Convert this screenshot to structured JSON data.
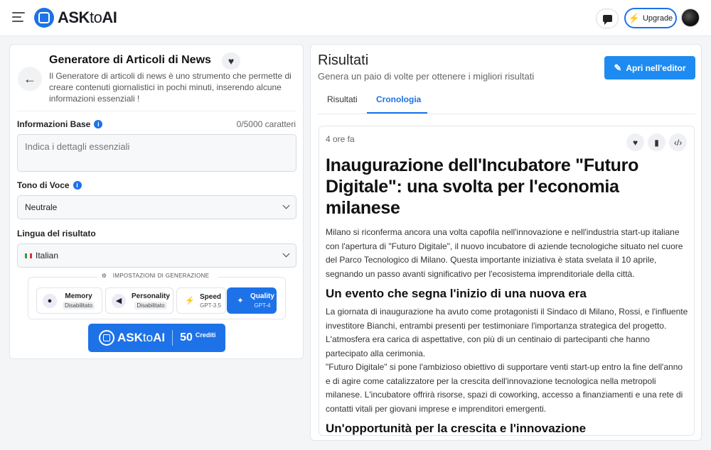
{
  "topbar": {
    "logo_brand_a": "ASK",
    "logo_brand_b": "to",
    "logo_brand_c": "AI",
    "upgrade_label": "Upgrade"
  },
  "generator": {
    "title": "Generatore di Articoli di News",
    "description": "Il Generatore di articoli di news è uno strumento che permette di creare contenuti giornalistici in pochi minuti, inserendo alcune informazioni essenziali !",
    "fields": {
      "base_info_label": "Informazioni Base",
      "char_count": "0/5000 caratteri",
      "base_info_placeholder": "Indica i dettagli essenziali",
      "tone_label": "Tono di Voce",
      "tone_value": "Neutrale",
      "language_label": "Lingua del risultato",
      "language_value": "Italian"
    },
    "settings_label": "IMPOSTAZIONI DI GENERAZIONE",
    "options": [
      {
        "name": "Memory",
        "status": "Disabilitato",
        "icon": "brain-icon"
      },
      {
        "name": "Personality",
        "status": "Disabilitato",
        "icon": "megaphone-icon"
      },
      {
        "name": "Speed",
        "status": "GPT-3.5",
        "icon": "bolt-icon"
      },
      {
        "name": "Quality",
        "status": "GPT-4",
        "icon": "sparkle-icon"
      }
    ],
    "credit_button": {
      "brand_a": "ASK",
      "brand_b": "to",
      "brand_c": "AI",
      "amount": "50",
      "unit": "Crediti"
    }
  },
  "results": {
    "title": "Risultati",
    "subtitle": "Genera un paio di volte per ottenere i migliori risultati",
    "editor_button": "Apri nell'editor",
    "tabs": [
      "Risultati",
      "Cronologia"
    ],
    "active_tab": "Cronologia",
    "card": {
      "time_ago": "4 ore fa",
      "heading": "Inaugurazione dell'Incubatore \"Futuro Digitale\": una svolta per l'economia milanese",
      "paragraph1": "Milano si riconferma ancora una volta capofila nell'innovazione e nell'industria start-up italiane con l'apertura di \"Futuro Digitale\", il nuovo incubatore di aziende tecnologiche situato nel cuore del Parco Tecnologico di Milano. Questa importante iniziativa è stata svelata il 10 aprile, segnando un passo avanti significativo per l'ecosistema imprenditoriale della città.",
      "subheading1": "Un evento che segna l'inizio di una nuova era",
      "paragraph2": "La giornata di inaugurazione ha avuto come protagonisti il Sindaco di Milano, Rossi, e l'influente investitore Bianchi, entrambi presenti per testimoniare l'importanza strategica del progetto. L'atmosfera era carica di aspettative, con più di un centinaio di partecipanti che hanno partecipato alla cerimonia.",
      "paragraph3": "\"Futuro Digitale\" si pone l'ambizioso obiettivo di supportare venti start-up entro la fine dell'anno e di agire come catalizzatore per la crescita dell'innovazione tecnologica nella metropoli milanese. L'incubatore offrirà risorse, spazi di coworking, accesso a finanziamenti e una rete di contatti vitali per giovani imprese e imprenditori emergenti.",
      "subheading2": "Un'opportunità per la crescita e l'innovazione"
    }
  },
  "colors": {
    "accent": "#1d72e8",
    "editor_button": "#1d8bf1"
  }
}
